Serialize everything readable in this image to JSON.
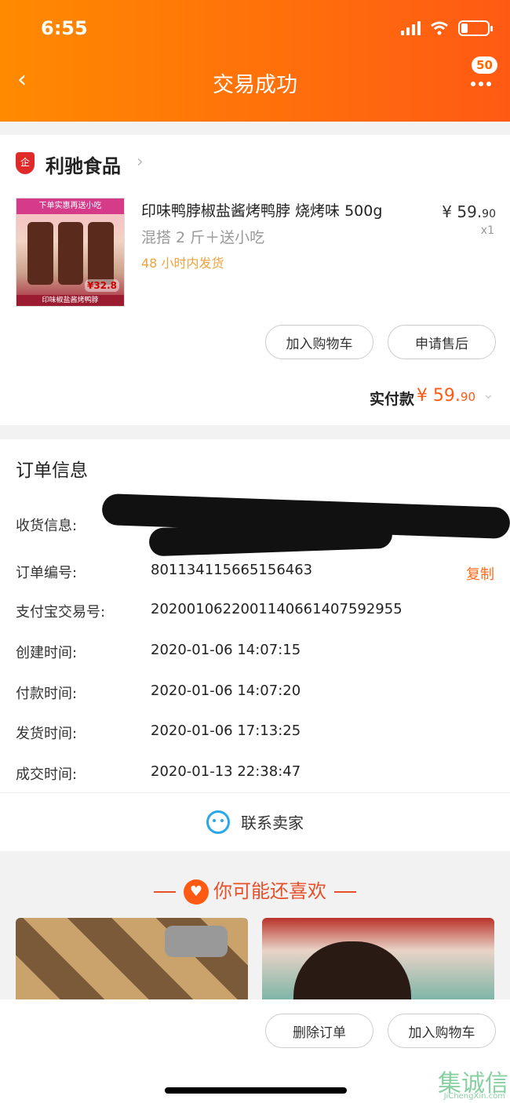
{
  "status_bar": {
    "time": "6:55"
  },
  "header": {
    "back_glyph": "‹",
    "title": "交易成功",
    "badge_count": "50"
  },
  "shop": {
    "logo_text": "企",
    "name": "利驰食品",
    "chevron": "›",
    "product": {
      "image_banner": "下单实惠再送小吃",
      "image_price": "¥32.8",
      "image_footer": "印味椒盐酱烤鸭脖",
      "title": "印味鸭脖椒盐酱烤鸭脖 烧烤味 500g",
      "spec": "混搭 2 斤＋送小吃",
      "shipping": "48 小时内发货",
      "price_main": "¥ 59.",
      "price_cents": "90",
      "quantity": "x1"
    },
    "buttons": {
      "add_cart": "加入购物车",
      "after_sale": "申请售后"
    },
    "total": {
      "label": "实付款",
      "value_main": "¥ 59.",
      "value_cents": "90"
    }
  },
  "order_info": {
    "heading": "订单信息",
    "rows": [
      {
        "label": "收货信息:",
        "value": ""
      },
      {
        "label": "订单编号:",
        "value": "801134115665156463"
      },
      {
        "label": "支付宝交易号:",
        "value": "2020010622001140661407592955"
      },
      {
        "label": "创建时间:",
        "value": "2020-01-06 14:07:15"
      },
      {
        "label": "付款时间:",
        "value": "2020-01-06 14:07:20"
      },
      {
        "label": "发货时间:",
        "value": "2020-01-06 17:13:25"
      },
      {
        "label": "成交时间:",
        "value": "2020-01-13 22:38:47"
      }
    ],
    "copy_label": "复制",
    "contact_label": "联系卖家"
  },
  "recommend": {
    "heading": "你可能还喜欢",
    "heart": "♥"
  },
  "bottom_bar": {
    "delete_order": "删除订单",
    "add_cart": "加入购物车"
  },
  "watermark": {
    "main": "集诚信",
    "sub": "JiChengXin.com"
  }
}
